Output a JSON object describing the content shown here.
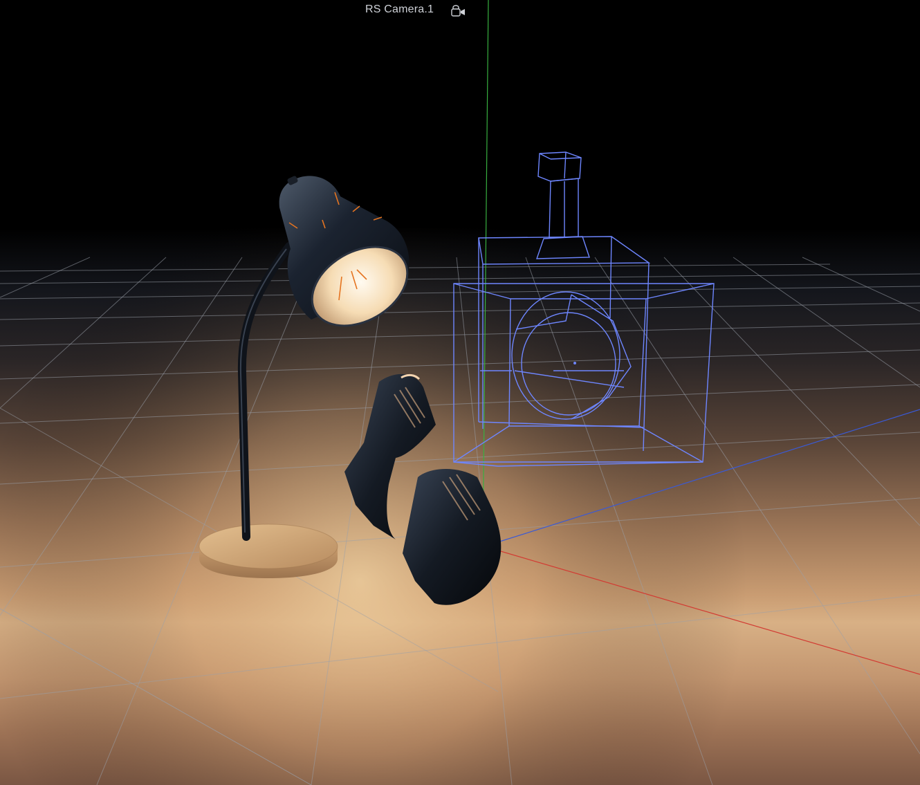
{
  "viewport": {
    "camera_name": "RS Camera.1",
    "camera_icon": "camera-lock-icon"
  },
  "scene": {
    "objects": [
      {
        "name": "desk-lamp",
        "kind": "mesh"
      },
      {
        "name": "lamp-shade-pieces",
        "kind": "mesh"
      },
      {
        "name": "camera-object",
        "kind": "wireframe"
      }
    ],
    "axis_colors": {
      "x": "#d23a32",
      "y": "#38b040",
      "z": "#3a5ad6"
    },
    "wireframe_color": "#6e86ff",
    "lamp_color": "#1c2028",
    "base_color": "#d2a878",
    "light_color": "#fff3d8"
  }
}
